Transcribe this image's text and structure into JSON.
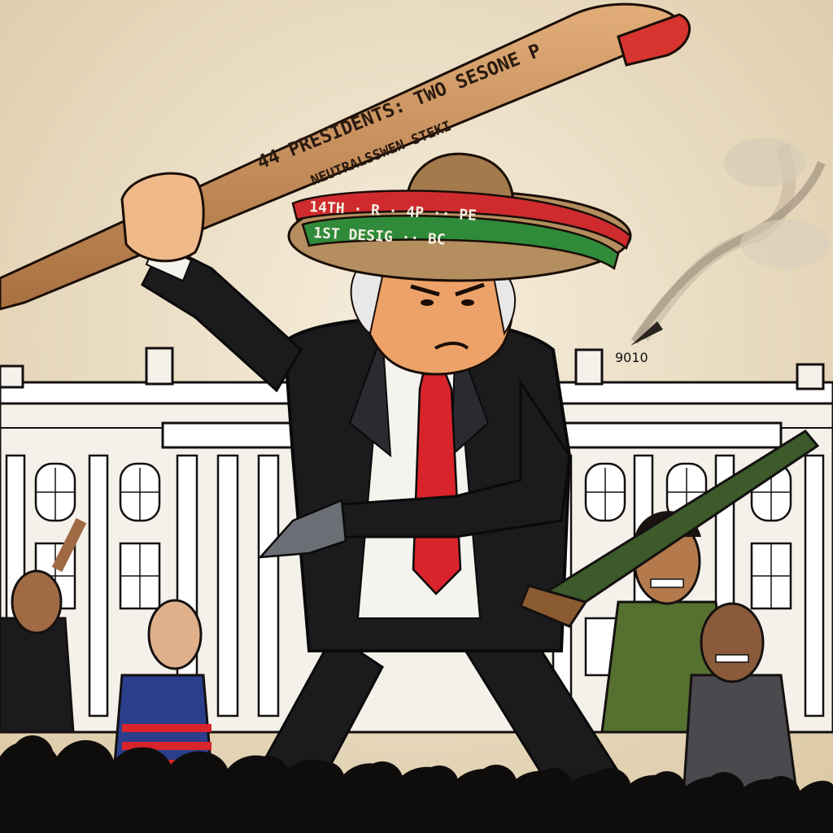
{
  "bat": {
    "line1": "44 PRESIDENTS: TWO SESONE P",
    "line2": "NEUTRALSSWEN STEKI"
  },
  "hat": {
    "band_line1": "14TH · R · 4P ·· PE",
    "band_line2": "1ST DESIG ·· BC"
  },
  "smoke_label": "9010",
  "colors": {
    "paper": "#efe4cf",
    "ink": "#141010",
    "suit": "#1b1b1e",
    "tie": "#d8242a",
    "bat": "#c8905a",
    "hat_red": "#cf2b2e",
    "hat_green": "#2f8a3a",
    "straw": "#b48e5e",
    "jacket_green": "#56702f"
  }
}
